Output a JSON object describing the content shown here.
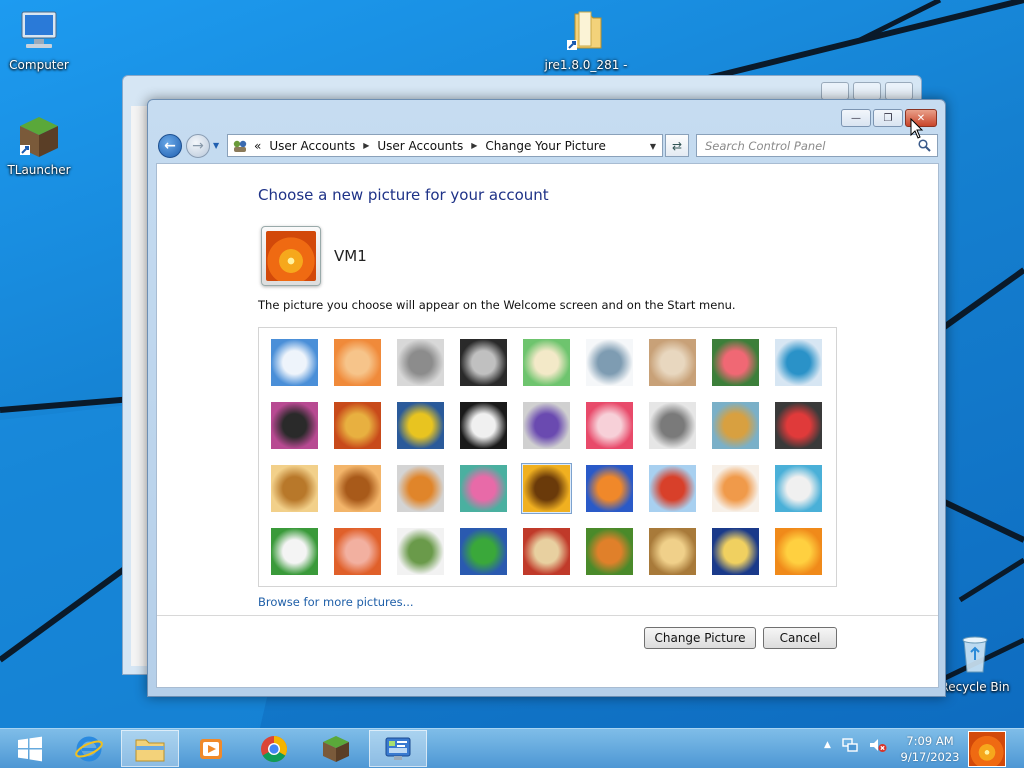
{
  "desktop": {
    "icons": [
      {
        "label": "Computer"
      },
      {
        "label": "TLauncher"
      },
      {
        "label": "jre1.8.0_281 -"
      },
      {
        "label": "Recycle Bin"
      }
    ]
  },
  "window": {
    "controls": {
      "minimize": "—",
      "maximize": "❐",
      "close": "✕"
    },
    "breadcrumb": [
      "User Accounts",
      "User Accounts",
      "Change Your Picture"
    ],
    "breadcrumb_prefix": "«",
    "search_placeholder": "Search Control Panel",
    "title": "Choose a new picture for your account",
    "account_name": "VM1",
    "description": "The picture you choose will appear on the Welcome screen and on the Start menu.",
    "pictures": [
      {
        "name": "roller-coaster",
        "colors": [
          "#4a8fd8",
          "#eef4fb"
        ]
      },
      {
        "name": "starfish",
        "colors": [
          "#f08a3a",
          "#f6c48a"
        ]
      },
      {
        "name": "robot-figure",
        "colors": [
          "#d8d8d8",
          "#8c8c8c"
        ]
      },
      {
        "name": "record-player",
        "colors": [
          "#2a2a2a",
          "#c0c0c0"
        ]
      },
      {
        "name": "lucky-cat",
        "colors": [
          "#6ec46e",
          "#f3e9c8"
        ]
      },
      {
        "name": "gyroscope",
        "colors": [
          "#f5f7f9",
          "#7e9cb2"
        ]
      },
      {
        "name": "kitten",
        "colors": [
          "#c8a178",
          "#e8d7bf"
        ]
      },
      {
        "name": "flower",
        "colors": [
          "#3c7f3a",
          "#f06874"
        ]
      },
      {
        "name": "pinwheel",
        "colors": [
          "#d7e6f3",
          "#2a92c8"
        ]
      },
      {
        "name": "ball",
        "colors": [
          "#b84a92",
          "#2a2a2a"
        ]
      },
      {
        "name": "fabric",
        "colors": [
          "#c84a1a",
          "#e8b040"
        ]
      },
      {
        "name": "leaf",
        "colors": [
          "#2a5a9a",
          "#e8c420"
        ]
      },
      {
        "name": "dog-border-collie",
        "colors": [
          "#1a1a1a",
          "#f0f0f0"
        ]
      },
      {
        "name": "crayons",
        "colors": [
          "#d0d0d0",
          "#6a4ab0"
        ]
      },
      {
        "name": "star-lantern",
        "colors": [
          "#e84a6a",
          "#f7d0d8"
        ]
      },
      {
        "name": "jacks",
        "colors": [
          "#e6e6e6",
          "#7a7a7a"
        ]
      },
      {
        "name": "stairs",
        "colors": [
          "#7ab0c8",
          "#d8a040"
        ]
      },
      {
        "name": "paper-crane",
        "colors": [
          "#3a3a3a",
          "#e03a3a"
        ]
      },
      {
        "name": "guitar",
        "colors": [
          "#f2d08a",
          "#b8782a"
        ]
      },
      {
        "name": "puppy",
        "colors": [
          "#f3b56a",
          "#a85a1a"
        ]
      },
      {
        "name": "toy-robot",
        "colors": [
          "#d4d4d4",
          "#e0852a"
        ]
      },
      {
        "name": "scarf",
        "colors": [
          "#4ab0a0",
          "#e86aa8"
        ]
      },
      {
        "name": "sunflower",
        "colors": [
          "#f0b020",
          "#6a3a0a"
        ]
      },
      {
        "name": "fish",
        "colors": [
          "#2a5ac8",
          "#f0882a"
        ]
      },
      {
        "name": "hot-air-balloon",
        "colors": [
          "#a8d0f0",
          "#d8402a"
        ]
      },
      {
        "name": "doll",
        "colors": [
          "#f7f0e8",
          "#f09a4a"
        ]
      },
      {
        "name": "sailboat",
        "colors": [
          "#4ab0d8",
          "#f0f0f0"
        ]
      },
      {
        "name": "soccer-ball",
        "colors": [
          "#3a9a3a",
          "#f4f4f4"
        ]
      },
      {
        "name": "stripes",
        "colors": [
          "#e0602a",
          "#f2b0a0"
        ]
      },
      {
        "name": "marbles",
        "colors": [
          "#f2f2f2",
          "#6a9a4a"
        ]
      },
      {
        "name": "window",
        "colors": [
          "#2a5ab0",
          "#3aa83a"
        ]
      },
      {
        "name": "rug",
        "colors": [
          "#c03a2a",
          "#e8d0a0"
        ]
      },
      {
        "name": "butterfly",
        "colors": [
          "#4a8a2a",
          "#e0802a"
        ]
      },
      {
        "name": "basket",
        "colors": [
          "#a87a3a",
          "#f0d08a"
        ]
      },
      {
        "name": "lighthouse",
        "colors": [
          "#1a3a8a",
          "#f0d060"
        ]
      },
      {
        "name": "orange-flower",
        "colors": [
          "#f08a1a",
          "#ffd040"
        ]
      }
    ],
    "selected_index": 22,
    "browse_link": "Browse for more pictures...",
    "buttons": {
      "change": "Change Picture",
      "cancel": "Cancel"
    }
  },
  "taskbar": {
    "apps": [
      "internet-explorer",
      "file-explorer",
      "media-player",
      "chrome",
      "minecraft",
      "control-panel"
    ],
    "active_app": "control-panel",
    "time": "7:09 AM",
    "date": "9/17/2023"
  },
  "colors": {
    "accent": "#1e3287",
    "link": "#1f5fa8",
    "desktop": "#1580d0"
  }
}
